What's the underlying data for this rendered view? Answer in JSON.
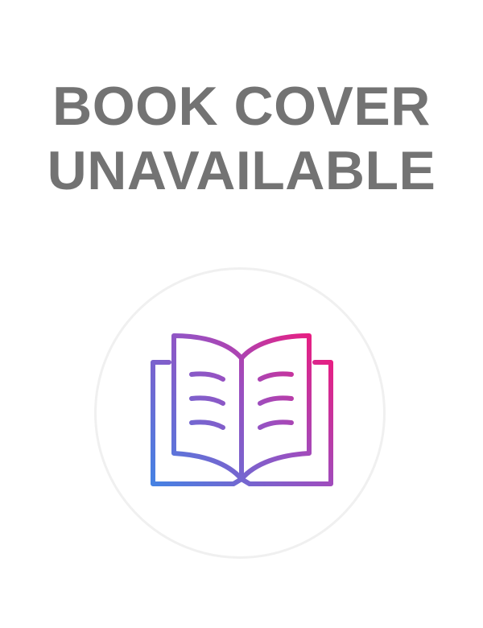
{
  "placeholder": {
    "title_line_1": "BOOK COVER",
    "title_line_2": "UNAVAILABLE",
    "icon": "open-book-icon",
    "colors": {
      "text": "#737373",
      "circle_border": "#f0f0f0",
      "gradient_start": "#3f86e6",
      "gradient_mid": "#9b4fc0",
      "gradient_end": "#ff0f6f"
    }
  }
}
